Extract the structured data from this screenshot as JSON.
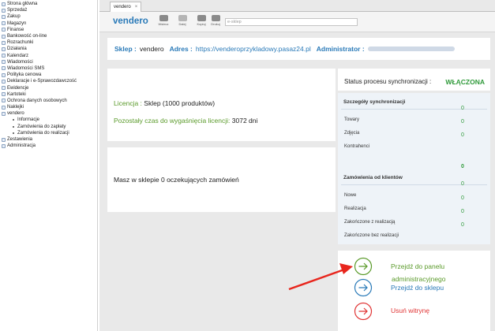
{
  "sidebar": {
    "items": [
      {
        "label": "Strona główna"
      },
      {
        "label": "Sprzedaż"
      },
      {
        "label": "Zakup"
      },
      {
        "label": "Magazyn"
      },
      {
        "label": "Finanse"
      },
      {
        "label": "Bankowość on-line"
      },
      {
        "label": "Rozrachunki"
      },
      {
        "label": "Działania"
      },
      {
        "label": "Kalendarz"
      },
      {
        "label": "Wiadomości"
      },
      {
        "label": "Wiadomości SMS"
      },
      {
        "label": "Polityka cenowa"
      },
      {
        "label": "Deklaracje i e-Sprawozdawczość"
      },
      {
        "label": "Ewidencje"
      },
      {
        "label": "Kartoteki"
      },
      {
        "label": "Ochrona danych osobowych"
      },
      {
        "label": "Naklejki"
      },
      {
        "label": "vendero"
      }
    ],
    "subitems": [
      {
        "label": "Informacje"
      },
      {
        "label": "Zamówienia do zapłaty"
      },
      {
        "label": "Zamówienia do realizacji"
      }
    ],
    "items_after": [
      {
        "label": "Zestawienia"
      },
      {
        "label": "Administracja"
      }
    ]
  },
  "tab": {
    "label": "vendero",
    "close": "×"
  },
  "toolbar": {
    "brand": "vendero",
    "buttons": [
      {
        "label": "Wstecz",
        "icon": "back-icon"
      },
      {
        "label": "Dalej",
        "icon": "forward-icon"
      },
      {
        "label": "Kopiuj",
        "icon": "copy-icon"
      },
      {
        "label": "Drukuj",
        "icon": "print-icon"
      }
    ],
    "search_placeholder": "e-sklep"
  },
  "info": {
    "shop_label": "Sklep :",
    "shop_value": "vendero",
    "address_label": "Adres :",
    "address_value": "https://venderoprzykladowy.pasaz24.pl",
    "admin_label": "Administrator :"
  },
  "license": {
    "label": "Licencja :",
    "value": "Sklep (1000 produktów)",
    "remaining_label": "Pozostały czas do wygaśnięcia licencji:",
    "remaining_value": "3072 dni"
  },
  "orders": {
    "text": "Masz w sklepie 0 oczekujących zamówień"
  },
  "status": {
    "label": "Status procesu synchronizacji :",
    "value": "WŁĄCZONA"
  },
  "sync": {
    "details_header": "Szczegóły synchronizacji",
    "details_top_value": "0",
    "details": [
      {
        "label": "Towary",
        "value": "0"
      },
      {
        "label": "Zdjęcia",
        "value": "0"
      },
      {
        "label": "Kontrahenci",
        "value": ""
      }
    ],
    "orders_value": "0",
    "orders_header": "Zamówienia od klientów",
    "orders_top_value": "0",
    "orders_rows": [
      {
        "label": "Nowe",
        "value": "0"
      },
      {
        "label": "Realizacja",
        "value": "0"
      },
      {
        "label": "Zakończone z realizacją",
        "value": "0"
      },
      {
        "label": "Zakończone bez realizacji",
        "value": ""
      }
    ]
  },
  "actions": {
    "admin_panel_1": "Przejdź do panelu",
    "admin_panel_2": "administracyjnego",
    "go_shop": "Przejdź do sklepu",
    "remove": "Usuń witrynę",
    "colors": {
      "green": "#5a9a2a",
      "blue": "#2a7ab8",
      "red": "#e03434"
    }
  }
}
